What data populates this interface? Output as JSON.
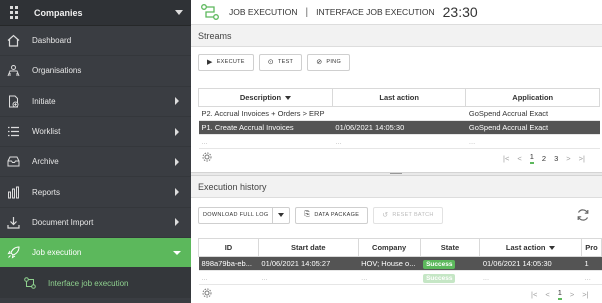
{
  "sidebar": {
    "header_title": "Companies",
    "items": [
      {
        "label": "Dashboard",
        "has_arrow": false
      },
      {
        "label": "Organisations",
        "has_arrow": false
      },
      {
        "label": "Initiate",
        "has_arrow": true
      },
      {
        "label": "Worklist",
        "has_arrow": true
      },
      {
        "label": "Archive",
        "has_arrow": true
      },
      {
        "label": "Reports",
        "has_arrow": true
      },
      {
        "label": "Document Import",
        "has_arrow": true
      },
      {
        "label": "Job execution",
        "has_arrow": true,
        "active": true
      }
    ],
    "sub_item": "Interface job execution",
    "colors": {
      "background": "#3a3d42",
      "active": "#5cb85c",
      "sub_text": "#8fd18f"
    }
  },
  "header": {
    "crumb1": "JOB EXECUTION",
    "separator": "|",
    "crumb2": "INTERFACE JOB EXECUTION",
    "time": "23:30"
  },
  "streams": {
    "title": "Streams",
    "buttons": {
      "execute": "EXECUTE",
      "test": "TEST",
      "ping": "PING"
    },
    "columns": [
      "Description",
      "Last action",
      "Application"
    ],
    "rows": [
      {
        "description": "P2. Accrual Invoices + Orders > ERP",
        "last_action": "",
        "application": "GoSpend Accrual Exact",
        "selected": false
      },
      {
        "description": "P1. Create Accrual Invoices",
        "last_action": "01/06/2021 14:05:30",
        "application": "GoSpend Accrual Exact",
        "selected": true
      },
      {
        "description": "...",
        "last_action": "...",
        "application": "...",
        "selected": false
      }
    ],
    "pager": {
      "pages": [
        "1",
        "2",
        "3"
      ],
      "current": "1"
    }
  },
  "history": {
    "title": "Execution history",
    "buttons": {
      "download": "DOWNLOAD FULL LOG",
      "data_package": "DATA PACKAGE",
      "reset_batch": "RESET BATCH"
    },
    "columns": [
      "ID",
      "Start date",
      "Company",
      "State",
      "Last action",
      "Pro"
    ],
    "rows": [
      {
        "id": "898a79ba-eb...",
        "start": "01/06/2021 14:05:27",
        "company": "HOV; House o...",
        "state": "Success",
        "last_action": "01/06/2021 14:05:30",
        "pro": "1",
        "selected": true
      },
      {
        "id": "...",
        "start": "...",
        "company": "...",
        "state": "Success",
        "last_action": "...",
        "pro": "...",
        "selected": false
      }
    ],
    "pager": {
      "pages": [
        "1"
      ],
      "current": "1"
    },
    "colors": {
      "success": "#5cb85c",
      "selected_row": "#545454"
    }
  }
}
